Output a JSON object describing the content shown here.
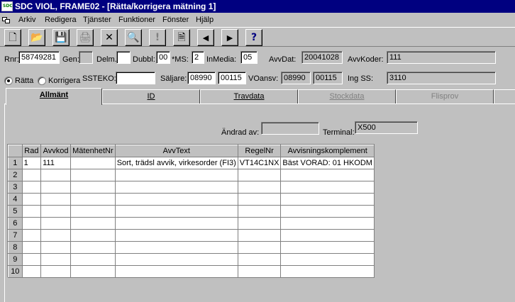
{
  "window": {
    "app_icon_text": "SDC",
    "title": "SDC VIOL, FRAME02 - [Rätta/korrigera mätning 1]"
  },
  "menu": [
    "Arkiv",
    "Redigera",
    "Tjänster",
    "Funktioner",
    "Fönster",
    "Hjälp"
  ],
  "toolbar": {
    "buttons": [
      {
        "icon": "new-document",
        "glyph": "🗋"
      },
      {
        "icon": "open-folder",
        "glyph": "📂"
      },
      {
        "icon": "save",
        "glyph": "💾"
      },
      {
        "icon": "print",
        "glyph": "🖨"
      },
      {
        "icon": "delete",
        "glyph": "✕"
      },
      {
        "icon": "find",
        "glyph": "🔍"
      },
      {
        "icon": "important",
        "glyph": "!"
      },
      {
        "icon": "new-page",
        "glyph": "🗎"
      },
      {
        "icon": "previous",
        "glyph": "◀"
      },
      {
        "icon": "next",
        "glyph": "▶"
      },
      {
        "icon": "help",
        "glyph": "?"
      }
    ]
  },
  "header": {
    "rnr_label": "Rnr:",
    "rnr_value": "58749281",
    "gen_label": "Gen:",
    "gen_value": "",
    "delm_label": "Delm.",
    "delm_value": "",
    "dubbl_label": "Dubbl:",
    "dubbl_value": "00",
    "ms_label": "*MS:",
    "ms_value": "2",
    "inmedia_label": "InMedia:",
    "inmedia_value": "05",
    "avvdat_label": "AvvDat:",
    "avvdat_value": "20041028",
    "avvkoder_label": "AvvKoder:",
    "avvkoder_value": "111",
    "ratta_label": "Rätta",
    "korrigera_label": "Korrigera",
    "ssteko_label": "SSTEKO:",
    "ssteko_value": "",
    "saljare_label": "Säljare:",
    "saljare_value1": "08990",
    "saljare_value2": "00115",
    "voansv_label": "VOansv:",
    "voansv_value1": "08990",
    "voansv_value2": "00115",
    "ingss_label": "Ing SS:",
    "ingss_value": "3110"
  },
  "tabs": [
    {
      "label": "Allmänt",
      "state": "active"
    },
    {
      "label": "ID",
      "state": "normal"
    },
    {
      "label": "Travdata",
      "state": "normal"
    },
    {
      "label": "Stockdata",
      "state": "disabled"
    },
    {
      "label": "Flisprov",
      "state": "disabled"
    },
    {
      "label": "",
      "state": "normal"
    }
  ],
  "panel": {
    "andrad_av_label": "Ändrad av:",
    "andrad_av_value": "",
    "terminal_label": "Terminal:",
    "terminal_value": "X500"
  },
  "grid": {
    "columns": [
      "Rad",
      "Avvkod",
      "MätenhetNr",
      "AvvText",
      "RegelNr",
      "Avvisningskomplement"
    ],
    "row_numbers": [
      "1",
      "2",
      "3",
      "4",
      "5",
      "6",
      "7",
      "8",
      "9",
      "10"
    ],
    "rows": [
      [
        "1",
        "111",
        "",
        "Sort, trädsl avvik, virkesorder (FI3)",
        "VT14C1NX",
        "Bäst VORAD: 01 HKODM"
      ]
    ]
  }
}
